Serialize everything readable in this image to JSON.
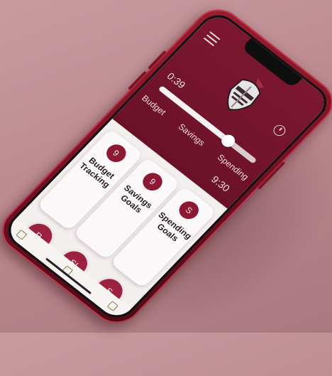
{
  "header": {
    "time_left": "0:39",
    "time_right": "9:30",
    "logo": "knight-helmet-logo"
  },
  "tabs": [
    {
      "label": "Budget"
    },
    {
      "label": "Savings"
    },
    {
      "label": "Spending"
    }
  ],
  "slider": {
    "value_fraction": 0.72
  },
  "cards": [
    {
      "title": "Budget Tracking",
      "badge": "9"
    },
    {
      "title": "Savings Goals",
      "badge": "9"
    },
    {
      "title": "Spending Goals",
      "badge": "S"
    }
  ],
  "bottom_buttons": [
    {
      "label": "R"
    },
    {
      "label": "SI"
    },
    {
      "label": "S"
    }
  ],
  "nav": {
    "icons": [
      "home-icon",
      "grid-icon",
      "settings-icon"
    ]
  },
  "colors": {
    "primary": "#7c1731",
    "accent": "#9a2140",
    "background": "#c89ba1"
  }
}
